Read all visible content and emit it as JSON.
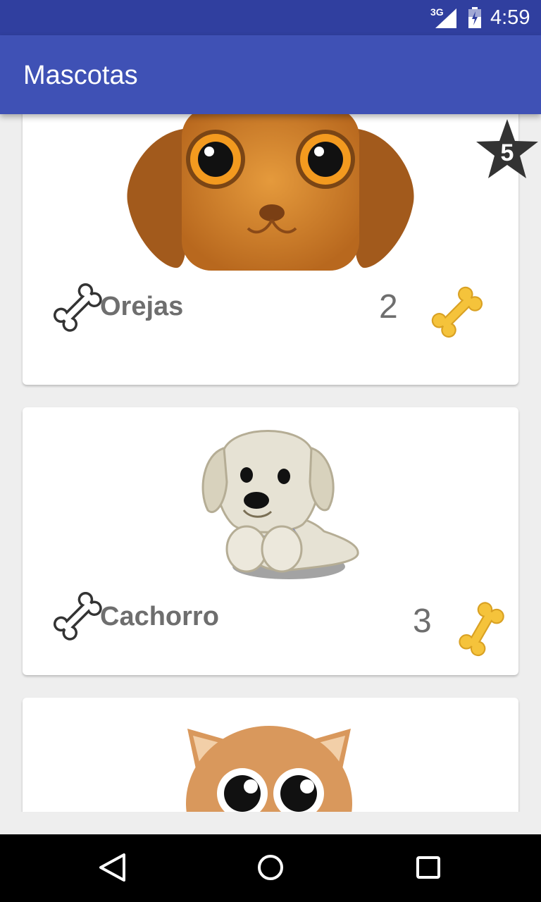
{
  "status_bar": {
    "network": "3G",
    "time": "4:59"
  },
  "app_bar": {
    "title": "Mascotas"
  },
  "pets": [
    {
      "name": "Orejas",
      "likes": "2",
      "image": "brown-dog-face"
    },
    {
      "name": "Cachorro",
      "likes": "3",
      "image": "white-puppy"
    },
    {
      "name": "",
      "likes": "",
      "image": "orange-cat"
    }
  ],
  "favorites_badge": {
    "count": "5",
    "icon": "star-icon"
  },
  "navigation_bar": {
    "buttons": [
      "back-icon",
      "home-icon",
      "recents-icon"
    ]
  },
  "colors": {
    "status_bar": "#303f9f",
    "app_bar": "#3f51b5",
    "background": "#eeeeee",
    "pet_name": "#6e6e6e",
    "gold_bone": "#f5c33b"
  }
}
